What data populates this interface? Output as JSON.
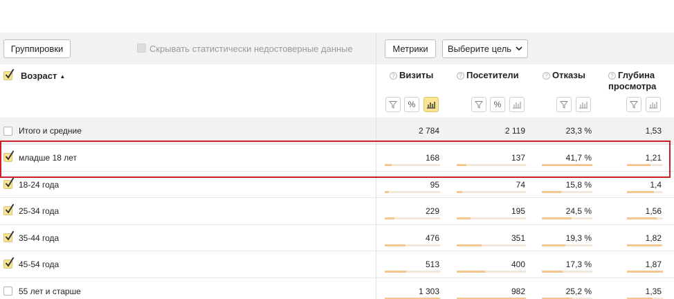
{
  "toolbar": {
    "groupings_label": "Группировки",
    "hide_unreliable_label": "Скрывать статистически недостоверные данные",
    "metrics_label": "Метрики",
    "goal_select_label": "Выберите цель"
  },
  "dimension": {
    "title": "Возраст",
    "sort_indicator": "▲"
  },
  "columns": [
    {
      "label_line1": "Визиты",
      "label_line2": ""
    },
    {
      "label_line1": "Посетители",
      "label_line2": ""
    },
    {
      "label_line1": "Отказы",
      "label_line2": ""
    },
    {
      "label_line1": "Глубина",
      "label_line2": "просмотра"
    }
  ],
  "total_row": {
    "label": "Итого и средние",
    "values": [
      "2 784",
      "2 119",
      "23,3 %",
      "1,53"
    ]
  },
  "rows": [
    {
      "label": "младше 18 лет",
      "checked": true,
      "values": [
        "168",
        "137",
        "41,7 %",
        "1,21"
      ],
      "bar_fractions": [
        0.13,
        0.14,
        1.0,
        0.65
      ]
    },
    {
      "label": "18-24 года",
      "checked": true,
      "values": [
        "95",
        "74",
        "15,8 %",
        "1,4"
      ],
      "bar_fractions": [
        0.07,
        0.08,
        0.38,
        0.75
      ]
    },
    {
      "label": "25-34 года",
      "checked": true,
      "values": [
        "229",
        "195",
        "24,5 %",
        "1,56"
      ],
      "bar_fractions": [
        0.18,
        0.2,
        0.59,
        0.83
      ]
    },
    {
      "label": "35-44 года",
      "checked": true,
      "values": [
        "476",
        "351",
        "19,3 %",
        "1,82"
      ],
      "bar_fractions": [
        0.37,
        0.36,
        0.46,
        0.97
      ]
    },
    {
      "label": "45-54 года",
      "checked": true,
      "values": [
        "513",
        "400",
        "17,3 %",
        "1,87"
      ],
      "bar_fractions": [
        0.39,
        0.41,
        0.41,
        1.0
      ]
    },
    {
      "label": "55 лет и старше",
      "checked": false,
      "values": [
        "1 303",
        "982",
        "25,2 %",
        "1,35"
      ],
      "bar_fractions": [
        1.0,
        1.0,
        0.6,
        0.72
      ]
    }
  ],
  "colors": {
    "accent": "#fbe590",
    "bar": "#f4c58f",
    "highlight": "#cc1f25"
  }
}
